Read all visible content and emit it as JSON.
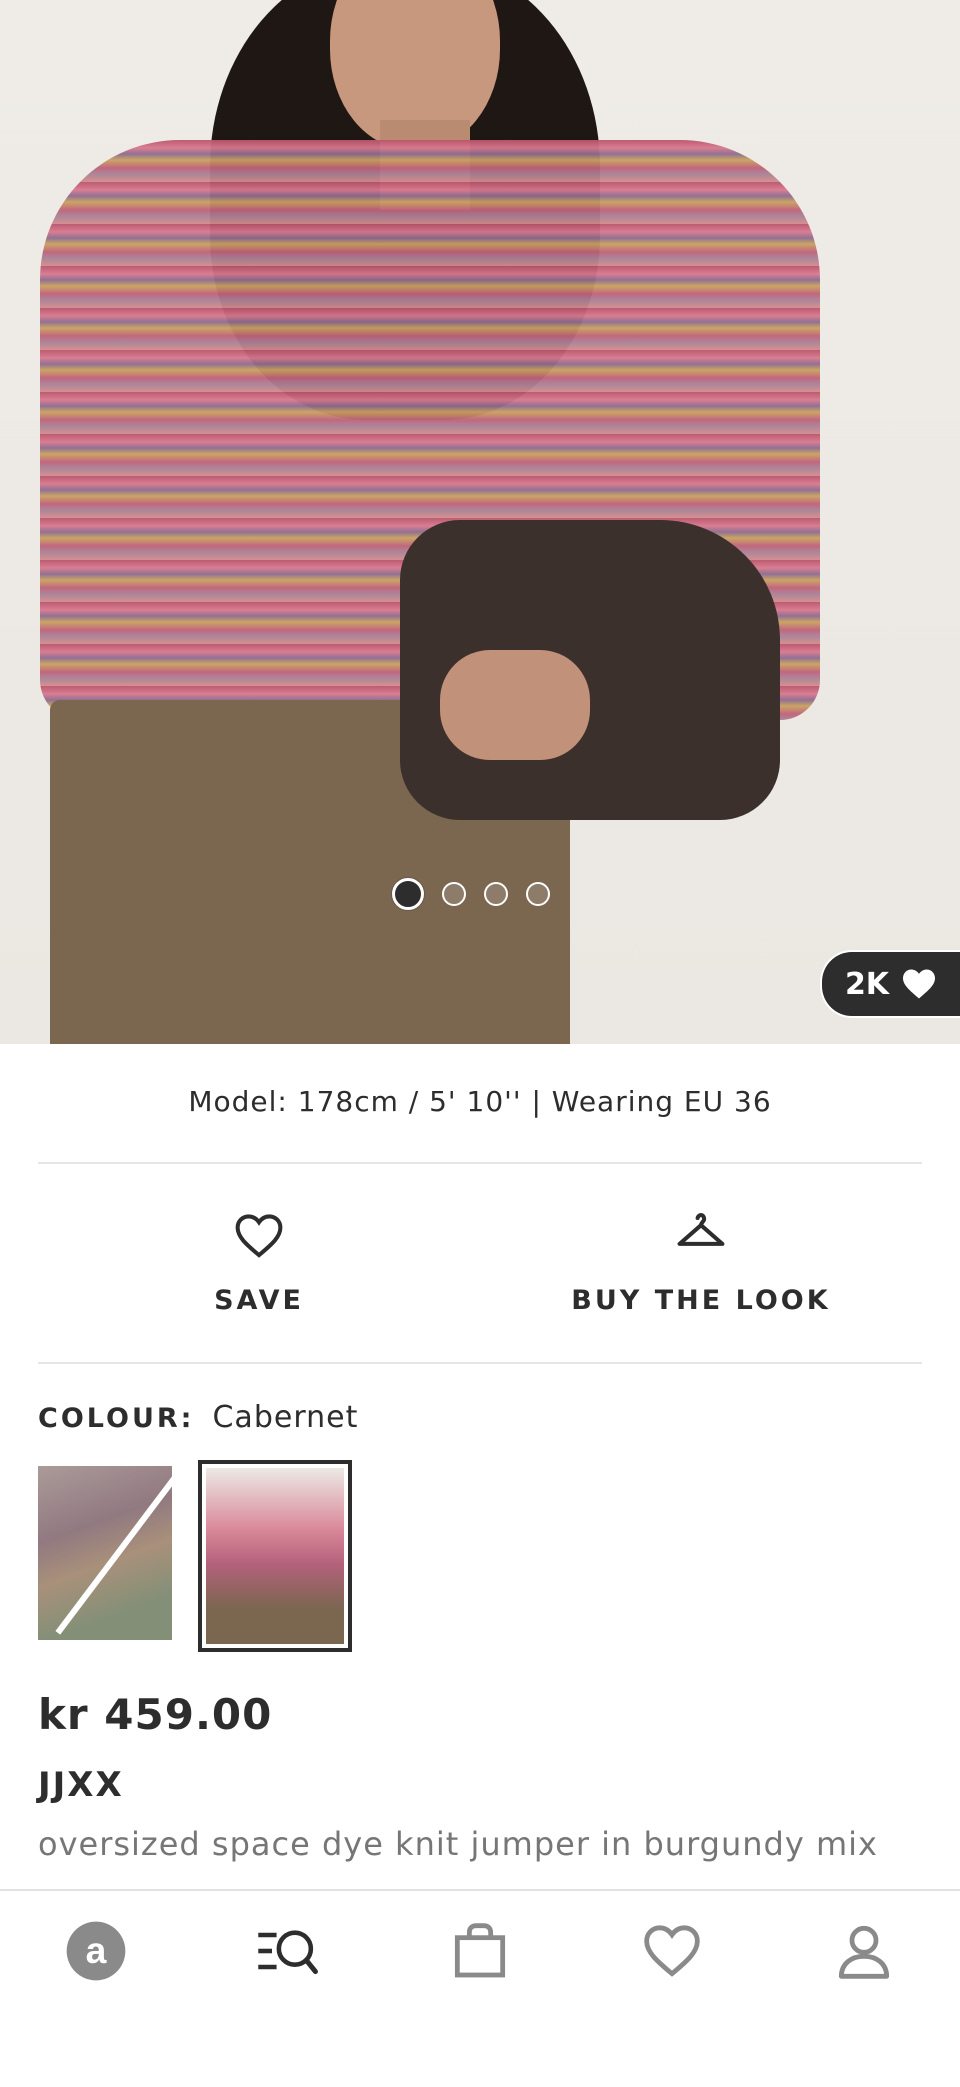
{
  "hero": {
    "image_alt": "Model wearing oversized space dye knit jumper",
    "carousel": {
      "count": 4,
      "active_index": 0
    },
    "likes": "2K"
  },
  "model_info": "Model: 178cm / 5' 10'' | Wearing EU 36",
  "actions": {
    "save_label": "SAVE",
    "buy_the_look_label": "BUY THE LOOK"
  },
  "colour": {
    "label": "COLOUR:",
    "value": "Cabernet"
  },
  "product": {
    "price": "kr 459.00",
    "brand": "JJXX",
    "name": "oversized space dye knit jumper in burgundy mix"
  },
  "tabbar": {
    "items": [
      "home-icon",
      "search-icon",
      "bag-icon",
      "heart-icon",
      "account-icon"
    ]
  },
  "colors": {
    "text": "#2d2d2d",
    "muted": "#767676",
    "divider": "#e6e6e6"
  }
}
